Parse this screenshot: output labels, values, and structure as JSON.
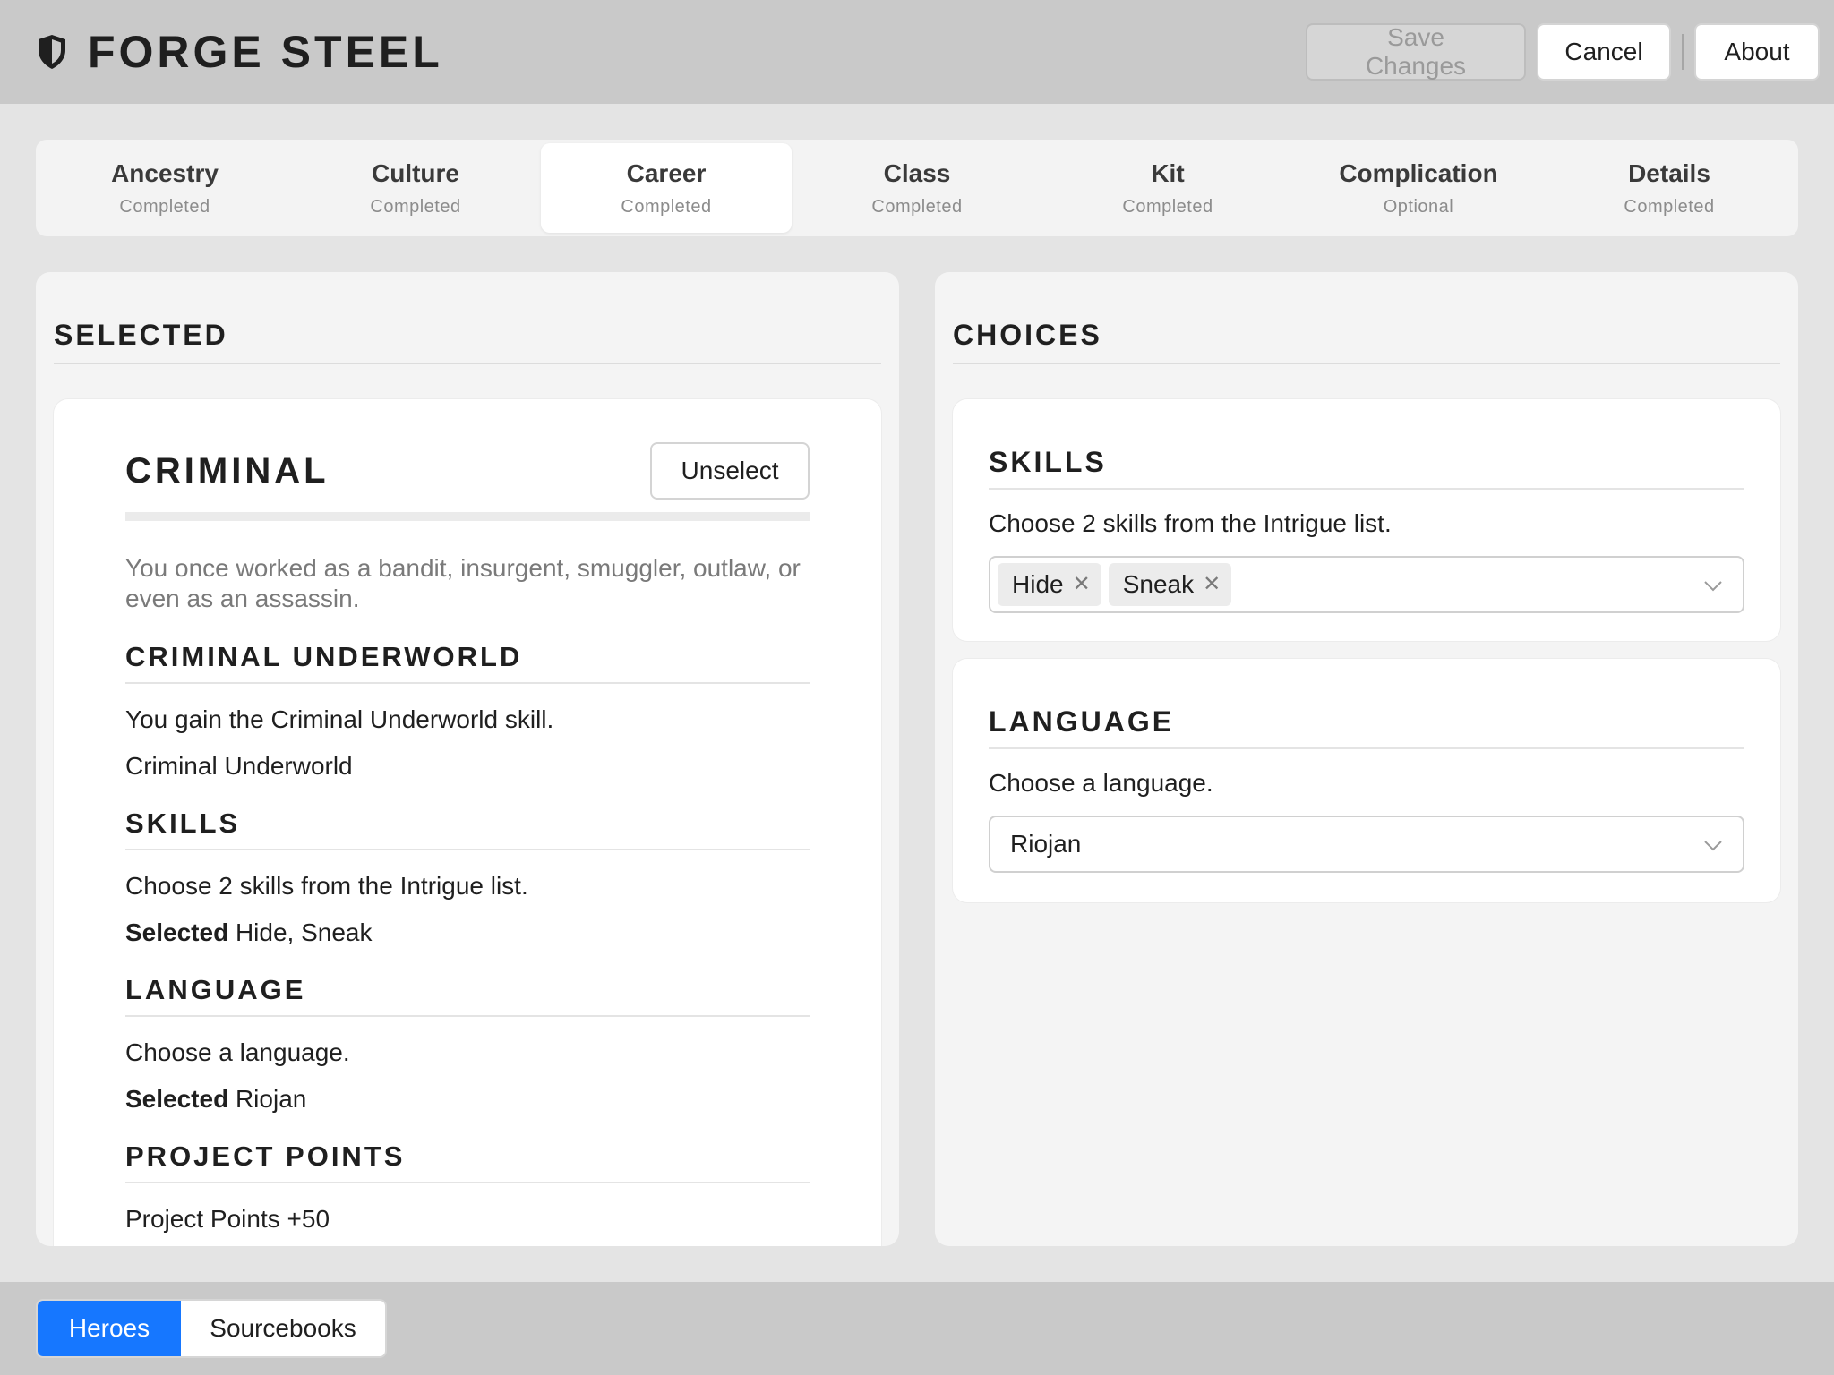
{
  "app": {
    "title": "FORGE STEEL",
    "logo_icon": "shield-icon"
  },
  "header": {
    "save_label": "Save Changes",
    "cancel_label": "Cancel",
    "about_label": "About"
  },
  "steps": [
    {
      "name": "Ancestry",
      "status": "Completed"
    },
    {
      "name": "Culture",
      "status": "Completed"
    },
    {
      "name": "Career",
      "status": "Completed"
    },
    {
      "name": "Class",
      "status": "Completed"
    },
    {
      "name": "Kit",
      "status": "Completed"
    },
    {
      "name": "Complication",
      "status": "Optional"
    },
    {
      "name": "Details",
      "status": "Completed"
    }
  ],
  "active_step": "Career",
  "selected_panel": {
    "heading": "SELECTED",
    "card": {
      "title": "CRIMINAL",
      "unselect_label": "Unselect",
      "description": "You once worked as a bandit, insurgent, smuggler, outlaw, or even as an assassin.",
      "sections": {
        "underworld": {
          "title": "CRIMINAL UNDERWORLD",
          "text": "You gain the Criminal Underworld skill.",
          "value": "Criminal Underworld"
        },
        "skills": {
          "title": "SKILLS",
          "text": "Choose 2 skills from the Intrigue list.",
          "selected_label": "Selected",
          "selected_value": "Hide, Sneak"
        },
        "language": {
          "title": "LANGUAGE",
          "text": "Choose a language.",
          "selected_label": "Selected",
          "selected_value": "Riojan"
        },
        "project_points": {
          "title": "PROJECT POINTS",
          "text": "Project Points +50"
        }
      }
    }
  },
  "choices_panel": {
    "heading": "CHOICES",
    "skills": {
      "title": "SKILLS",
      "text": "Choose 2 skills from the Intrigue list.",
      "tags": [
        "Hide",
        "Sneak"
      ]
    },
    "language": {
      "title": "LANGUAGE",
      "text": "Choose a language.",
      "value": "Riojan"
    }
  },
  "footer": {
    "tabs": [
      "Heroes",
      "Sourcebooks"
    ],
    "active": "Heroes"
  },
  "colors": {
    "accent": "#1677ff",
    "header_bg": "#c9c9c9",
    "page_bg": "#e4e4e4"
  }
}
